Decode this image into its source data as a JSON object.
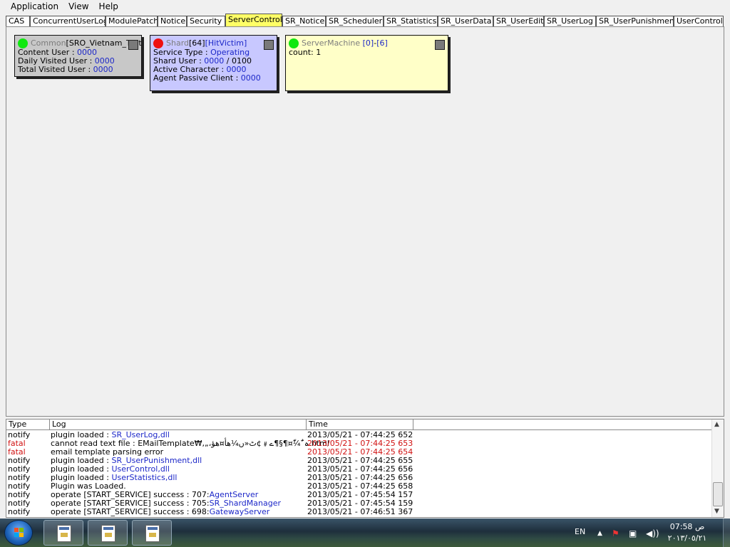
{
  "menu": [
    "Application",
    "View",
    "Help"
  ],
  "tabs": [
    "CAS",
    "ConcurrentUserLog",
    "ModulePatch",
    "Notice",
    "Security",
    "ServerControl",
    "SR_Notice",
    "SR_Scheduler",
    "SR_Statistics",
    "SR_UserData",
    "SR_UserEdit",
    "SR_UserLog",
    "SR_UserPunishment",
    "UserControl"
  ],
  "active_tab": "ServerControl",
  "cards": {
    "common": {
      "prefix": "Common",
      "name": "[SRO_Vietnam_TestL",
      "status_color": "#10e810",
      "lines": [
        {
          "label": "Content User : ",
          "value": "0000"
        },
        {
          "label": "Daily Visited User : ",
          "value": "0000"
        },
        {
          "label": "Total Visited User : ",
          "value": "0000"
        }
      ]
    },
    "shard": {
      "prefix": "Shard",
      "id": "[64]",
      "name": "[HitVictim]",
      "status_color": "#ee1010",
      "lines": [
        {
          "label": "Service Type : ",
          "value": "Operating"
        },
        {
          "label": "Shard User : ",
          "value": "0000",
          "suffix": " / 0100"
        },
        {
          "label": "Active Character : ",
          "value": "0000"
        },
        {
          "label": "Agent Passive Client : ",
          "value": "0000"
        }
      ]
    },
    "machine": {
      "prefix": "ServerMachine",
      "range_a": "[0]",
      "range_sep": " - ",
      "range_b": "[6]",
      "status_color": "#10e810",
      "count": "count: 1"
    }
  },
  "log": {
    "headers": [
      "Type",
      "Log",
      "Time"
    ],
    "rows": [
      {
        "type": "notify",
        "text": "plugin loaded : ",
        "link": "SR_UserLog,dll",
        "time": "2013/05/21 - 07:44:25 652",
        "level": "notify"
      },
      {
        "type": "fatal",
        "text": "cannot read text file : EMailTemplate₩,„،ہ¯ٌ¼ّ¤¶§¶ے﹟¢ٹ«ں¼هأ¤هؤ.html",
        "link": "",
        "time": "2013/05/21 - 07:44:25 653",
        "level": "fatal"
      },
      {
        "type": "fatal",
        "text": "email template parsing error",
        "link": "",
        "time": "2013/05/21 - 07:44:25 654",
        "level": "fatal"
      },
      {
        "type": "notify",
        "text": "plugin loaded : ",
        "link": "SR_UserPunishment,dll",
        "time": "2013/05/21 - 07:44:25 655",
        "level": "notify"
      },
      {
        "type": "notify",
        "text": "plugin loaded : ",
        "link": "UserControl,dll",
        "time": "2013/05/21 - 07:44:25 656",
        "level": "notify"
      },
      {
        "type": "notify",
        "text": "plugin loaded : ",
        "link": "UserStatistics,dll",
        "time": "2013/05/21 - 07:44:25 656",
        "level": "notify"
      },
      {
        "type": "notify",
        "text": "Plugin was Loaded.",
        "link": "",
        "time": "2013/05/21 - 07:44:25 658",
        "level": "notify"
      },
      {
        "type": "notify",
        "text": "operate [START_SERVICE] success : 707:",
        "link": "AgentServer",
        "time": "2013/05/21 - 07:45:54 157",
        "level": "notify"
      },
      {
        "type": "notify",
        "text": "operate [START_SERVICE] success : 705:",
        "link": "SR_ShardManager",
        "time": "2013/05/21 - 07:45:54 159",
        "level": "notify"
      },
      {
        "type": "notify",
        "text": "operate [START_SERVICE] success : 698:",
        "link": "GatewayServer",
        "time": "2013/05/21 - 07:46:51 367",
        "level": "notify"
      }
    ]
  },
  "taskbar": {
    "lang": "EN",
    "time": "07:58 ص",
    "date": "٢٠١٣/٠٥/٢١",
    "icons": [
      "start-orb",
      "app-window-1",
      "app-window-2",
      "app-window-3"
    ]
  },
  "colors": {
    "active_tab": "#ffff66",
    "common_card": "#c8c8c8",
    "shard_card": "#c8c8ff",
    "machine_card": "#ffffc8",
    "link": "#1c27c8",
    "fatal": "#d01010"
  }
}
